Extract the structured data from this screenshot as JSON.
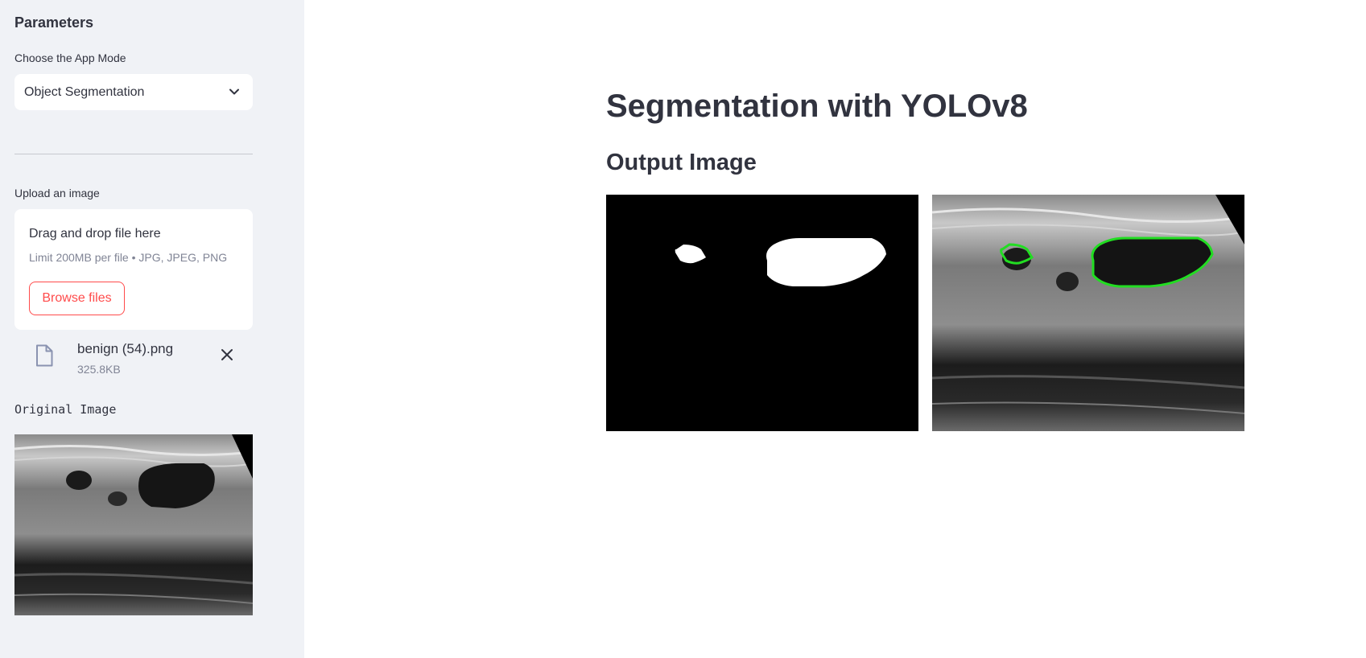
{
  "sidebar": {
    "title": "Parameters",
    "mode_label": "Choose the App Mode",
    "mode_value": "Object Segmentation",
    "upload_label": "Upload an image",
    "dropzone": {
      "main_text": "Drag and drop file here",
      "sub_text": "Limit 200MB per file • JPG, JPEG, PNG",
      "browse_label": "Browse files"
    },
    "file": {
      "name": "benign (54).png",
      "size": "325.8KB"
    },
    "original_caption": "Original Image"
  },
  "main": {
    "title": "Segmentation with YOLOv8",
    "subtitle": "Output Image"
  },
  "colors": {
    "accent": "#ff4b4b",
    "sidebar_bg": "#f0f2f6",
    "contour": "#22dd22"
  },
  "icons": {
    "select_chevron": "chevron-down-icon",
    "file": "file-icon",
    "remove": "close-icon"
  }
}
